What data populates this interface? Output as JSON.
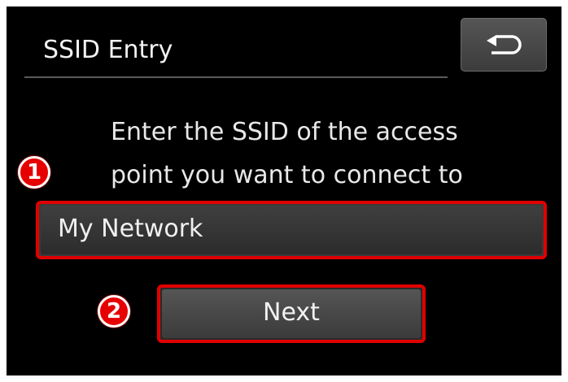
{
  "header": {
    "title": "SSID Entry",
    "back_icon": "return-arrow-icon"
  },
  "main": {
    "instruction_lines": [
      "Enter the SSID of the access",
      "point you want to connect to"
    ],
    "ssid_field": {
      "value": "My Network"
    },
    "next_label": "Next"
  },
  "annotations": {
    "marker_1": "1",
    "marker_2": "2",
    "highlight_color": "#e00000"
  },
  "colors": {
    "screen_background": "#000000",
    "button_background": "#4a4a4a",
    "text": "#f0f0f0"
  }
}
